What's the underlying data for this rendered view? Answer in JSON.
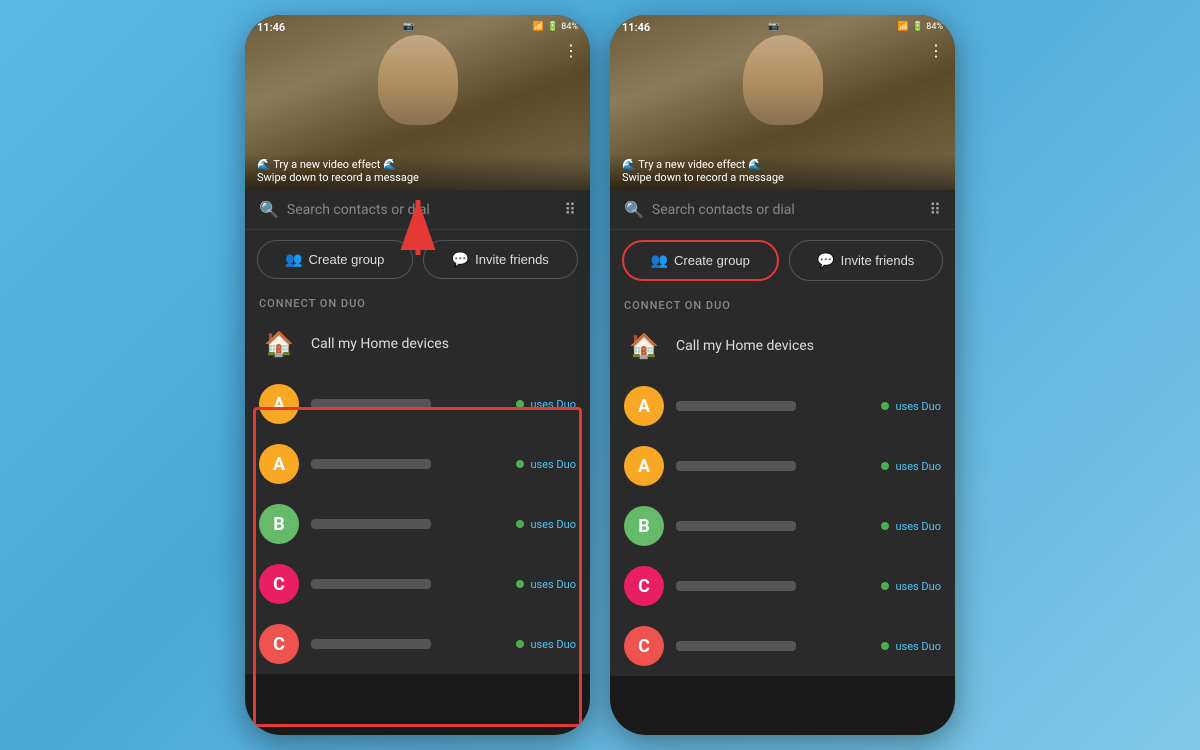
{
  "background": {
    "color": "#5bb8e8"
  },
  "phones": [
    {
      "id": "left",
      "statusBar": {
        "time": "11:46",
        "battery": "84%"
      },
      "camera": {
        "notification1": "🌊 Try a new video effect 🌊",
        "notification2": "Swipe down to record a message"
      },
      "search": {
        "placeholder": "Search contacts or dial"
      },
      "buttons": {
        "createGroup": "Create group",
        "inviteFriends": "Invite friends"
      },
      "sectionLabel": "CONNECT ON DUO",
      "homeDevice": "Call my Home devices",
      "contacts": [
        {
          "initial": "A",
          "color": "#f9a825",
          "usesDuo": true
        },
        {
          "initial": "A",
          "color": "#f9a825",
          "usesDuo": true
        },
        {
          "initial": "B",
          "color": "#66bb6a",
          "usesDuo": true
        },
        {
          "initial": "C",
          "color": "#e91e63",
          "usesDuo": true
        },
        {
          "initial": "C",
          "color": "#ef5350",
          "usesDuo": true
        }
      ],
      "highlights": {
        "contactsRedBorder": true,
        "showArrow": true
      }
    },
    {
      "id": "right",
      "statusBar": {
        "time": "11:46",
        "battery": "84%"
      },
      "camera": {
        "notification1": "🌊 Try a new video effect 🌊",
        "notification2": "Swipe down to record a message"
      },
      "search": {
        "placeholder": "Search contacts or dial"
      },
      "buttons": {
        "createGroup": "Create group",
        "inviteFriends": "Invite friends"
      },
      "sectionLabel": "CONNECT ON DUO",
      "homeDevice": "Call my Home devices",
      "contacts": [
        {
          "initial": "A",
          "color": "#f9a825",
          "usesDuo": true
        },
        {
          "initial": "A",
          "color": "#f9a825",
          "usesDuo": true
        },
        {
          "initial": "B",
          "color": "#66bb6a",
          "usesDuo": true
        },
        {
          "initial": "C",
          "color": "#e91e63",
          "usesDuo": true
        },
        {
          "initial": "C",
          "color": "#ef5350",
          "usesDuo": true
        }
      ],
      "highlights": {
        "createGroupRedBorder": true,
        "showArrow": false
      }
    }
  ],
  "icons": {
    "search": "🔍",
    "dialPad": "⠿",
    "createGroup": "👥",
    "inviteFriends": "💬",
    "homeDevice": "🏠"
  },
  "labels": {
    "usesDuo": "uses Duo"
  }
}
